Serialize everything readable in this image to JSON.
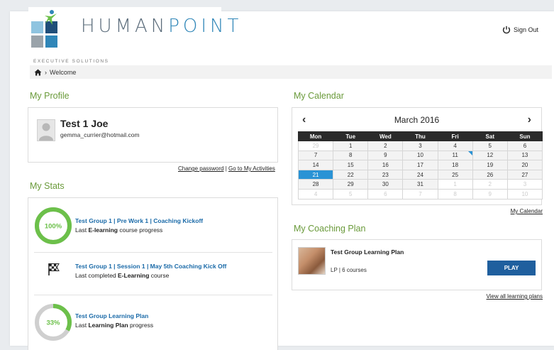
{
  "header": {
    "logo_human": "HUMAN",
    "logo_point": "POINT",
    "logo_sub": "EXECUTIVE SOLUTIONS",
    "signout_label": "Sign Out"
  },
  "breadcrumb": {
    "current": "Welcome"
  },
  "profile": {
    "title": "My Profile",
    "name": "Test 1 Joe",
    "email": "gemma_currier@hotmail.com",
    "change_password": "Change password",
    "separator": "|",
    "activities": "Go to My Activities"
  },
  "stats": {
    "title": "My Stats",
    "items": [
      {
        "title": "Test Group 1 | Pre Work 1 | Coaching Kickoff",
        "sub_pre": "Last ",
        "sub_bold": "E-learning",
        "sub_post": " course progress",
        "progress_label": "100%",
        "progress": 1.0
      },
      {
        "title": "Test Group 1 | Session 1 | May 5th Coaching Kick Off",
        "sub_pre": "Last completed ",
        "sub_bold": "E-Learning",
        "sub_post": " course"
      },
      {
        "title": "Test Group Learning Plan",
        "sub_pre": "Last ",
        "sub_bold": "Learning Plan",
        "sub_post": " progress",
        "progress_label": "33%",
        "progress": 0.33
      }
    ]
  },
  "calendar": {
    "title": "My Calendar",
    "month": "March 2016",
    "prev": "‹",
    "next": "›",
    "days": [
      "Mon",
      "Tue",
      "Wed",
      "Thu",
      "Fri",
      "Sat",
      "Sun"
    ],
    "weeks": [
      [
        "29",
        "1",
        "2",
        "3",
        "4",
        "5",
        "6"
      ],
      [
        "7",
        "8",
        "9",
        "10",
        "11",
        "12",
        "13"
      ],
      [
        "14",
        "15",
        "16",
        "17",
        "18",
        "19",
        "20"
      ],
      [
        "21",
        "22",
        "23",
        "24",
        "25",
        "26",
        "27"
      ],
      [
        "28",
        "29",
        "30",
        "31",
        "1",
        "2",
        "3"
      ],
      [
        "4",
        "5",
        "6",
        "7",
        "8",
        "9",
        "10"
      ]
    ],
    "link": "My Calendar"
  },
  "coaching": {
    "title": "My Coaching Plan",
    "plan_title": "Test Group Learning Plan",
    "plan_sub": "LP | 6 courses",
    "play_label": "PLAY",
    "view_all": "View all learning plans"
  },
  "colors": {
    "accent_green": "#6a9a3a",
    "link_blue": "#1a6aa8",
    "button_blue": "#1f5f9e",
    "selected_blue": "#2a93d5",
    "progress_green": "#6cc04a"
  },
  "icons": {
    "home": "home-icon",
    "power": "power-icon",
    "flag": "checkered-flag-icon",
    "avatar": "user-avatar-icon"
  }
}
